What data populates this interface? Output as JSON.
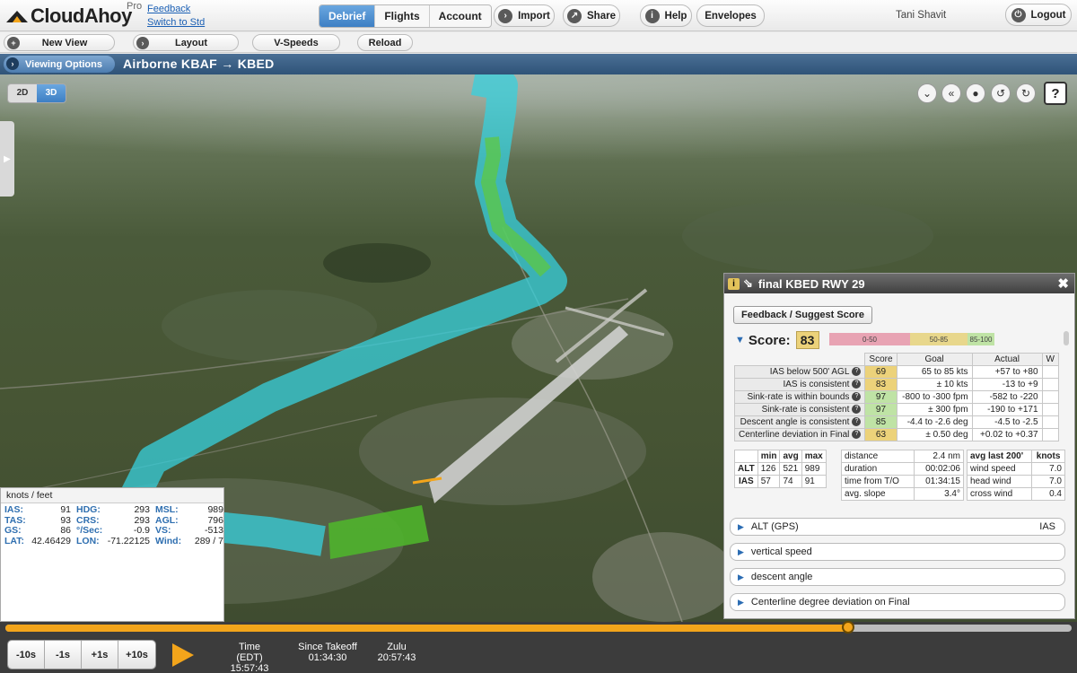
{
  "app": {
    "name": "CloudAhoy",
    "tier": "Pro",
    "feedback_link": "Feedback",
    "switch_link": "Switch to Std"
  },
  "nav_tabs": [
    {
      "label": "Debrief",
      "active": true
    },
    {
      "label": "Flights",
      "active": false
    },
    {
      "label": "Account",
      "active": false
    }
  ],
  "top_buttons": {
    "import": "Import",
    "share": "Share",
    "help": "Help",
    "envelopes": "Envelopes",
    "logout": "Logout"
  },
  "user": {
    "name": "Tani Shavit"
  },
  "toolbar": {
    "new_view": "New View",
    "layout": "Layout",
    "vspeeds": "V-Speeds",
    "reload": "Reload"
  },
  "titlebar": {
    "viewing_options": "Viewing Options",
    "flight_title": "Airborne KBAF → KBED"
  },
  "map": {
    "mode_2d": "2D",
    "mode_3d": "3D",
    "active_mode": "3D",
    "help": "?",
    "side_toggle": "▶",
    "bottom_toggle": "▼"
  },
  "databox": {
    "units": "knots / feet",
    "rows": [
      [
        {
          "k": "IAS:",
          "v": "91"
        },
        {
          "k": "HDG:",
          "v": "293"
        },
        {
          "k": "MSL:",
          "v": "989"
        }
      ],
      [
        {
          "k": "TAS:",
          "v": "93"
        },
        {
          "k": "CRS:",
          "v": "293"
        },
        {
          "k": "AGL:",
          "v": "796"
        }
      ],
      [
        {
          "k": "GS:",
          "v": "86"
        },
        {
          "k": "°/Sec:",
          "v": "-0.9"
        },
        {
          "k": "VS:",
          "v": "-513"
        }
      ],
      [
        {
          "k": "LAT:",
          "v": "42.46429"
        },
        {
          "k": "LON:",
          "v": "-71.22125"
        },
        {
          "k": "Wind:",
          "v": "289 / 7"
        }
      ]
    ]
  },
  "panel": {
    "title": "final KBED RWY 29",
    "feedback_button": "Feedback / Suggest Score",
    "score_label": "Score:",
    "score_value": "83",
    "scale": [
      {
        "label": "0-50",
        "color": "#e8a3b3"
      },
      {
        "label": "50-85",
        "color": "#e8d78c"
      },
      {
        "label": "85-100",
        "color": "#bfe3a5"
      }
    ],
    "headers": {
      "score": "Score",
      "goal": "Goal",
      "actual": "Actual",
      "extra": "W"
    },
    "criteria": [
      {
        "name": "IAS below 500' AGL",
        "score": "69",
        "goal": "65 to 85 kts",
        "actual": "+57 to +80",
        "color": "#ecd27a"
      },
      {
        "name": "IAS is consistent",
        "score": "83",
        "goal": "± 10 kts",
        "actual": "-13 to +9",
        "color": "#ecd27a"
      },
      {
        "name": "Sink-rate is within bounds",
        "score": "97",
        "goal": "-800 to -300 fpm",
        "actual": "-582 to -220",
        "color": "#bfe3a5"
      },
      {
        "name": "Sink-rate is consistent",
        "score": "97",
        "goal": "± 300 fpm",
        "actual": "-190 to +171",
        "color": "#bfe3a5"
      },
      {
        "name": "Descent angle is consistent",
        "score": "85",
        "goal": "-4.4 to -2.6 deg",
        "actual": "-4.5 to -2.5",
        "color": "#bfe3a5"
      },
      {
        "name": "Centerline deviation in Final",
        "score": "63",
        "goal": "± 0.50 deg",
        "actual": "+0.02 to +0.37",
        "color": "#ecd27a"
      }
    ],
    "minmax": {
      "headers": [
        "",
        "min",
        "avg",
        "max"
      ],
      "rows": [
        [
          "ALT",
          "126",
          "521",
          "989"
        ],
        [
          "IAS",
          "57",
          "74",
          "91"
        ]
      ]
    },
    "summary": [
      [
        "distance",
        "2.4 nm"
      ],
      [
        "duration",
        "00:02:06"
      ],
      [
        "time from T/O",
        "01:34:15"
      ],
      [
        "avg. slope",
        "3.4°"
      ]
    ],
    "wind": {
      "headers": [
        "avg last 200'",
        "knots"
      ],
      "rows": [
        [
          "wind speed",
          "7.0"
        ],
        [
          "head wind",
          "7.0"
        ],
        [
          "cross wind",
          "0.4"
        ]
      ]
    },
    "sections": [
      {
        "label": "ALT (GPS)",
        "right": "IAS"
      },
      {
        "label": "vertical speed",
        "right": ""
      },
      {
        "label": "descent angle",
        "right": ""
      },
      {
        "label": "Centerline degree deviation on Final",
        "right": ""
      }
    ]
  },
  "playback": {
    "progress": 0.79,
    "steps": [
      "-10s",
      "-1s",
      "+1s",
      "+10s"
    ],
    "time_edt_label": "Time (EDT)",
    "time_edt": "15:57:43",
    "since_takeoff_label": "Since Takeoff",
    "since_takeoff": "01:34:30",
    "zulu_label": "Zulu",
    "zulu": "20:57:43"
  },
  "colors": {
    "accent": "#3d7fc4",
    "timeline": "#f3a51b",
    "path_cyan": "#37d0de",
    "path_green": "#5fc93a",
    "path_gray": "#cfcfcf"
  }
}
